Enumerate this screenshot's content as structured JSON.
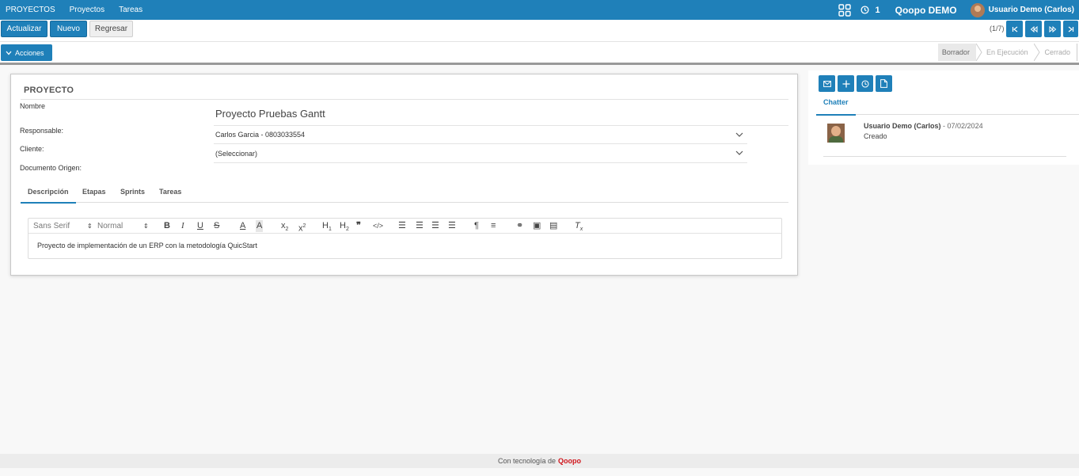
{
  "topnav": {
    "menu": [
      "PROYECTOS",
      "Proyectos",
      "Tareas"
    ],
    "activity_count": "1",
    "company": "Qoopo DEMO",
    "user": "Usuario Demo (Carlos)"
  },
  "toolbar": {
    "refresh_label": "Actualizar",
    "new_label": "Nuevo",
    "back_label": "Regresar",
    "pager": "(1/7)"
  },
  "actionbar": {
    "actions_label": "Acciones",
    "status_steps": [
      "Borrador",
      "En Ejecución",
      "Cerrado"
    ],
    "active_step": "Borrador"
  },
  "form": {
    "title": "PROYECTO",
    "name_label": "Nombre",
    "name_value": "Proyecto Pruebas Gantt",
    "responsible_label": "Responsable:",
    "responsible_value": "Carlos Garcia - 0803033554",
    "client_label": "Cliente:",
    "client_value": "(Seleccionar)",
    "origin_label": "Documento Origen:",
    "tabs": [
      "Descripción",
      "Etapas",
      "Sprints",
      "Tareas"
    ],
    "active_tab": "Descripción",
    "editor": {
      "font": "Sans Serif",
      "size": "Normal",
      "content": "Proyecto de implementación de un ERP con la metodología QuicStart"
    }
  },
  "chatter": {
    "tab": "Chatter",
    "messages": [
      {
        "author": "Usuario Demo (Carlos)",
        "date": " - 07/02/2024",
        "body": "Creado"
      }
    ]
  },
  "footer": {
    "text": "Con tecnología de",
    "brand": "Qoopo"
  },
  "colors": {
    "primary": "#1f80b9",
    "brand": "#d0161d"
  }
}
